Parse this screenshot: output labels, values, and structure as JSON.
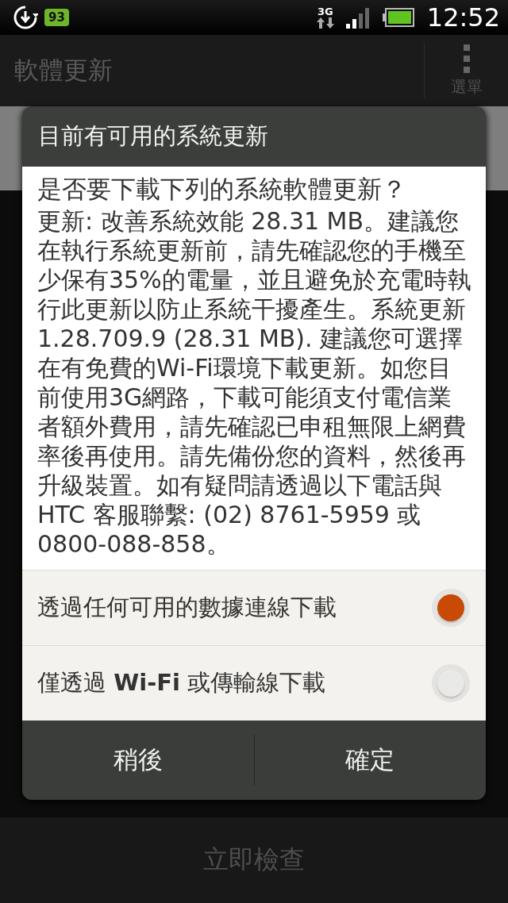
{
  "status_bar": {
    "notification_badge": "93",
    "network": "3G",
    "time": "12:52"
  },
  "app_bar": {
    "title": "軟體更新",
    "menu_label": "選單"
  },
  "bottom_bar": {
    "button": "立即檢查"
  },
  "dialog": {
    "title": "目前有可用的系統更新",
    "question": "是否要下載下列的系統軟體更新？",
    "message": "更新: 改善系統效能 28.31 MB。建議您在執行系統更新前，請先確認您的手機至少保有35%的電量，並且避免於充電時執行此更新以防止系統干擾產生。系統更新1.28.709.9 (28.31 MB). 建議您可選擇在有免費的Wi-Fi環境下載更新。如您目前使用3G網路，下載可能須支付電信業者額外費用，請先確認已申租無限上網費率後再使用。請先備份您的資料，然後再升級裝置。如有疑問請透過以下電話與HTC 客服聯繫: (02) 8761-5959 或 0800-088-858。",
    "options": [
      {
        "label": "透過任何可用的數據連線下載",
        "selected": true
      },
      {
        "label": "僅透過 **Wi-Fi** 或傳輸線下載",
        "selected": false
      }
    ],
    "buttons": [
      "稍後",
      "確定"
    ]
  }
}
